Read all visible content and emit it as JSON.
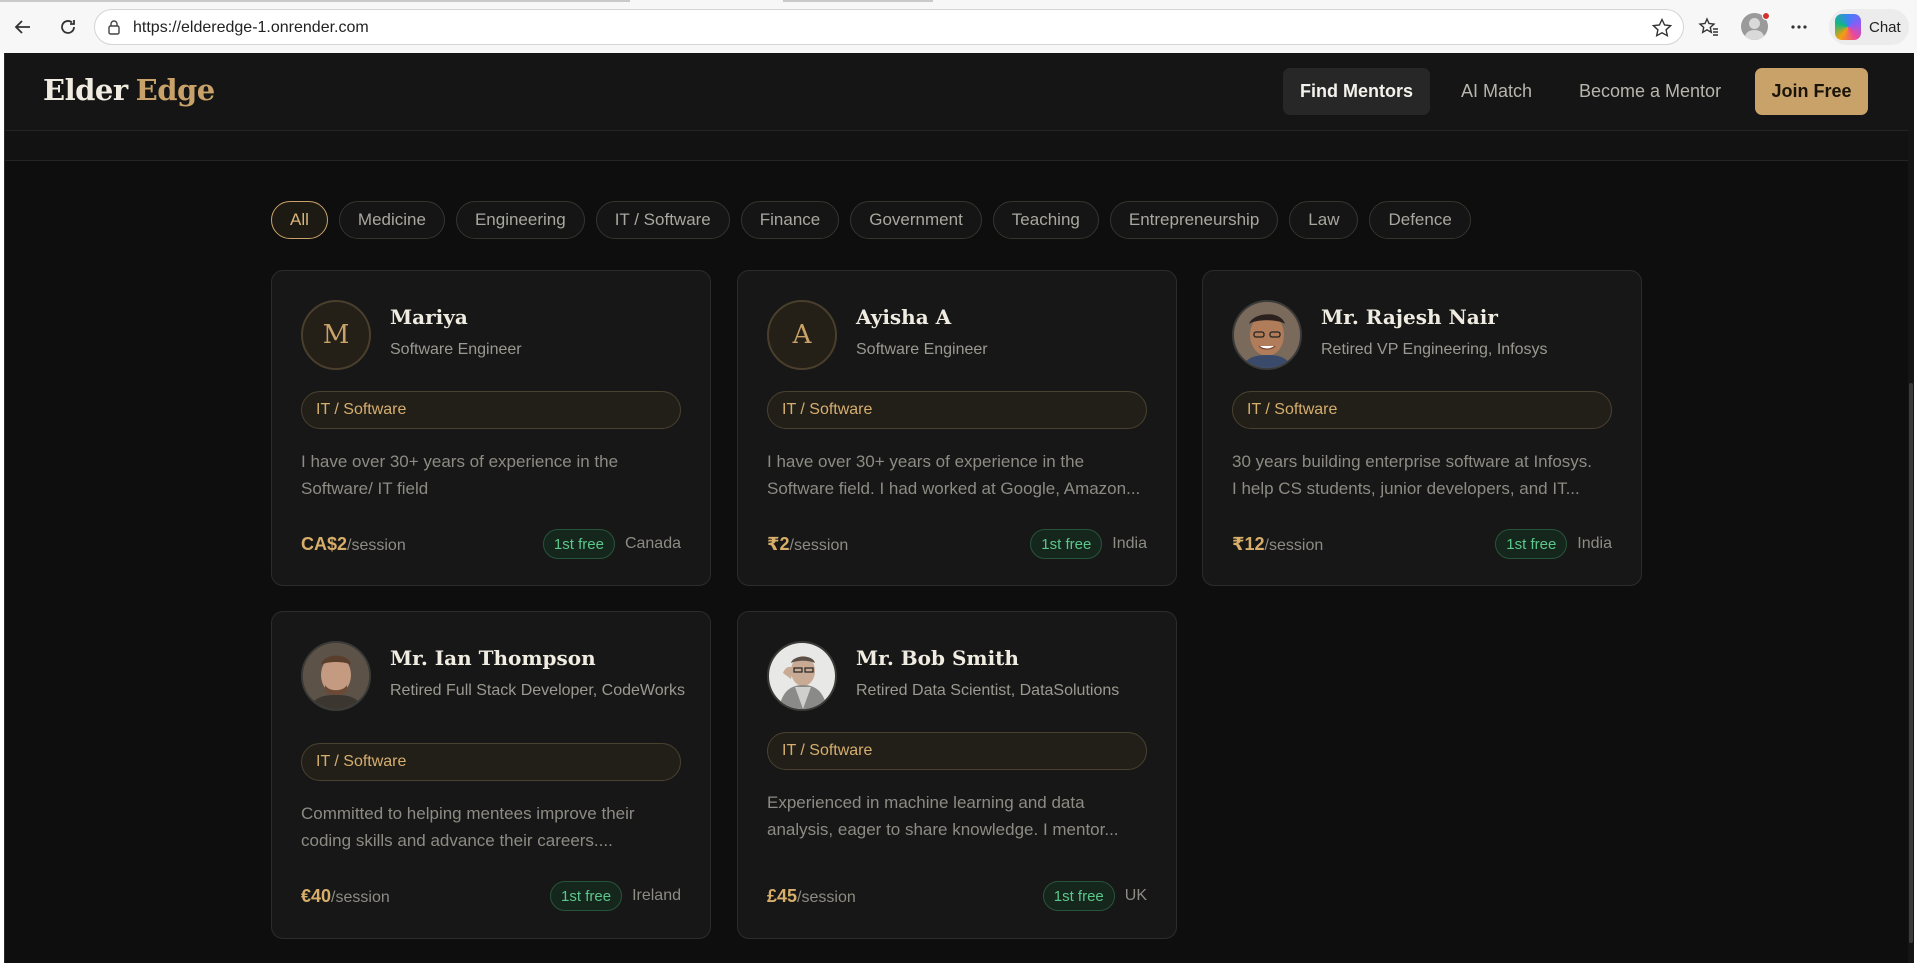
{
  "browser": {
    "url": "https://elderedge-1.onrender.com",
    "chat_label": "Chat"
  },
  "header": {
    "brand_part1": "Elder",
    "brand_part2": "Edge",
    "nav": [
      "Find Mentors",
      "AI Match",
      "Become a Mentor"
    ],
    "join_label": "Join Free"
  },
  "filters": [
    "All",
    "Medicine",
    "Engineering",
    "IT / Software",
    "Finance",
    "Government",
    "Teaching",
    "Entrepreneurship",
    "Law",
    "Defence"
  ],
  "active_filter": "All",
  "colors": {
    "accent": "#c9a26a",
    "background": "#0d0e0d",
    "free_badge": "#5bc78a"
  },
  "mentors": [
    {
      "initial": "M",
      "name": "Mariya",
      "role": "Software Engineer",
      "category": "IT / Software",
      "description_l1": "I have over 30+ years of experience in the",
      "description_l2": "Software/ IT field",
      "price": "CA$2",
      "per": "/session",
      "badge": "1st free",
      "country": "Canada"
    },
    {
      "initial": "A",
      "name": "Ayisha A",
      "role": "Software Engineer",
      "category": "IT / Software",
      "description_l1": "I have over 30+ years of experience in the",
      "description_l2": "Software field. I had worked at Google, Amazon...",
      "price": "₹2",
      "per": "/session",
      "badge": "1st free",
      "country": "India"
    },
    {
      "name": "Mr. Rajesh Nair",
      "role": "Retired VP Engineering, Infosys",
      "category": "IT / Software",
      "description_l1": "30 years building enterprise software at Infosys.",
      "description_l2": "I help CS students, junior developers, and IT...",
      "price": "₹12",
      "per": "/session",
      "badge": "1st free",
      "country": "India"
    },
    {
      "name": "Mr. Ian Thompson",
      "role": "Retired Full Stack Developer, CodeWorks",
      "category": "IT / Software",
      "description_l1": "Committed to helping mentees improve their",
      "description_l2": "coding skills and advance their careers....",
      "price": "€40",
      "per": "/session",
      "badge": "1st free",
      "country": "Ireland"
    },
    {
      "name": "Mr. Bob Smith",
      "role": "Retired Data Scientist, DataSolutions",
      "category": "IT / Software",
      "description_l1": "Experienced in machine learning and data",
      "description_l2": "analysis, eager to share knowledge. I mentor...",
      "price": "£45",
      "per": "/session",
      "badge": "1st free",
      "country": "UK"
    }
  ]
}
